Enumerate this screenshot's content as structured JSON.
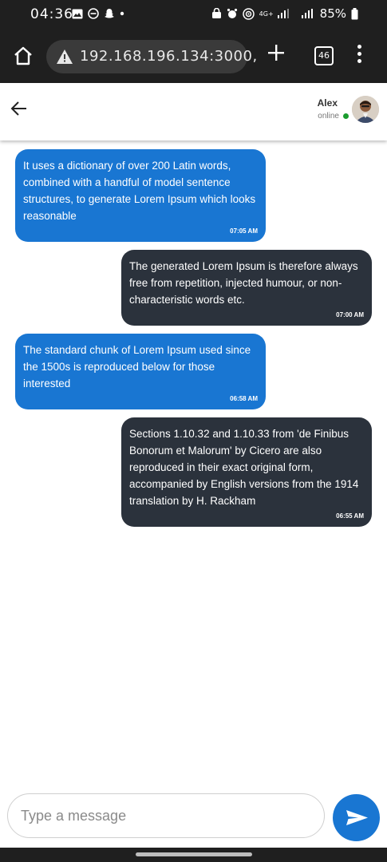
{
  "status_bar": {
    "time": "04:36",
    "battery": "85%",
    "network": "4G+"
  },
  "browser": {
    "url": "192.168.196.134:3000,",
    "tab_count": "46"
  },
  "chat_header": {
    "name": "Alex",
    "status": "online"
  },
  "messages": [
    {
      "direction": "in",
      "text": "It uses a dictionary of over 200 Latin words, combined with a handful of model sentence structures, to generate Lorem Ipsum which looks reasonable",
      "time": "07:05 AM"
    },
    {
      "direction": "out",
      "text": "The generated Lorem Ipsum is therefore always free from repetition, injected humour, or non-characteristic words etc.",
      "time": "07:00 AM"
    },
    {
      "direction": "in",
      "text": "The standard chunk of Lorem Ipsum used since the 1500s is reproduced below for those interested",
      "time": "06:58 AM"
    },
    {
      "direction": "out",
      "text": "Sections 1.10.32 and 1.10.33 from 'de Finibus Bonorum et Malorum' by Cicero are also reproduced in their exact original form, accompanied by English versions from the 1914 translation by H. Rackham",
      "time": "06:55 AM"
    }
  ],
  "composer": {
    "placeholder": "Type a message"
  },
  "colors": {
    "incoming_bubble": "#1976d2",
    "outgoing_bubble": "#2b323c",
    "online_indicator": "#1a9c2e",
    "browser_chrome": "#1f1f1f"
  },
  "icons": [
    "home-icon",
    "warning-icon",
    "plus-icon",
    "tabs-icon",
    "more-vert-icon",
    "back-arrow-icon",
    "send-icon"
  ]
}
